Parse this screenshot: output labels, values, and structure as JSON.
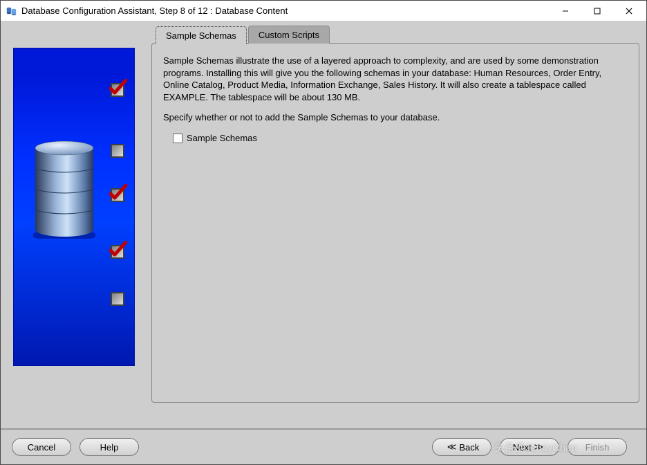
{
  "window": {
    "title": "Database Configuration Assistant, Step 8 of 12 : Database Content"
  },
  "tabs": {
    "sample_schemas": "Sample Schemas",
    "custom_scripts": "Custom Scripts"
  },
  "content": {
    "description1": "Sample Schemas illustrate the use of a layered approach to complexity, and are used by some demonstration programs. Installing this will give you the following schemas in your database: Human Resources, Order Entry, Online Catalog, Product Media, Information Exchange, Sales History. It will also create a tablespace called EXAMPLE. The tablespace will be about 130 MB.",
    "description2": "Specify whether or not to add the Sample Schemas to your database.",
    "checkbox_label": "Sample Schemas"
  },
  "buttons": {
    "cancel": "Cancel",
    "help": "Help",
    "back": "Back",
    "next": "Next",
    "finish": "Finish"
  },
  "watermark": "头条＠JencyChen"
}
